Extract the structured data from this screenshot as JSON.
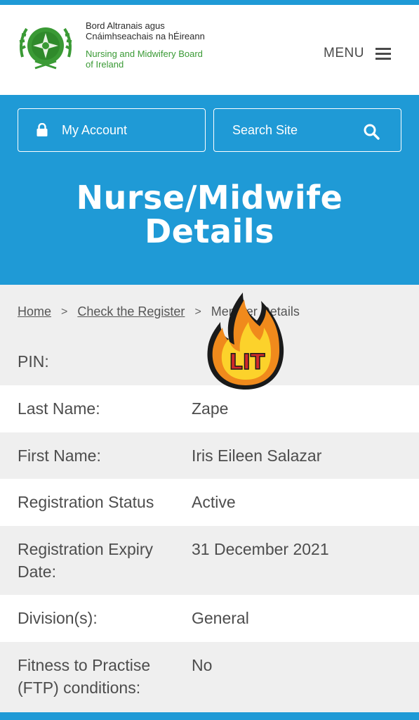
{
  "header": {
    "org_name_irish_1": "Bord Altranais agus",
    "org_name_irish_2": "Cnáimhseachais na hÉireann",
    "org_name_english_1": "Nursing and Midwifery Board",
    "org_name_english_2": "of Ireland",
    "menu_label": "MENU",
    "logo_icon": "nmbi-crest-logo",
    "menu_icon": "hamburger-icon"
  },
  "hero": {
    "account_label": "My Account",
    "search_label": "Search Site",
    "title_line1": "Nurse/Midwife",
    "title_line2": "Details",
    "background_color": "#1f9ad6"
  },
  "breadcrumb": {
    "home": "Home",
    "check_register": "Check the Register",
    "current": "Member Details"
  },
  "details": [
    {
      "label": "PIN:",
      "value": ""
    },
    {
      "label": "Last Name:",
      "value": "Zape"
    },
    {
      "label": "First Name:",
      "value": "Iris Eileen Salazar"
    },
    {
      "label": "Registration Status",
      "value": "Active"
    },
    {
      "label_line1": "Registration Expiry",
      "label_line2": "Date:",
      "value": "31 December 2021"
    },
    {
      "label": "Division(s):",
      "value": "General"
    },
    {
      "label_line1": "Fitness to Practise",
      "label_line2": "(FTP) conditions:",
      "value": "No"
    }
  ],
  "sticker": {
    "text": "LIT",
    "icon": "fire-emoji-sticker"
  }
}
